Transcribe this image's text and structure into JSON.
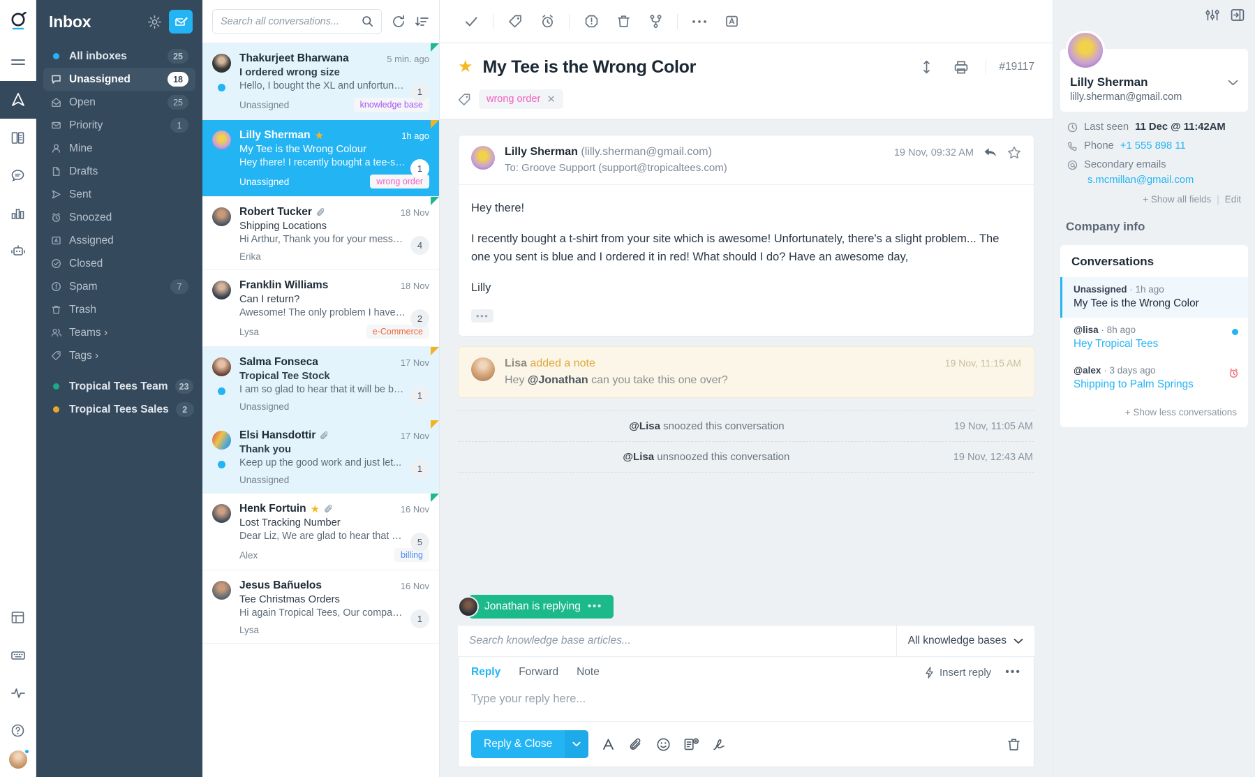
{
  "rail": {
    "logo": "groove-logo",
    "items": [
      {
        "name": "menu-icon",
        "active": false
      },
      {
        "name": "navigator-icon",
        "active": true
      },
      {
        "name": "knowledge-base-icon",
        "active": false
      },
      {
        "name": "chat-icon",
        "active": false
      },
      {
        "name": "reports-icon",
        "active": false
      },
      {
        "name": "bot-icon",
        "active": false
      },
      {
        "name": "grid-icon",
        "active": false
      },
      {
        "name": "keyboard-icon",
        "active": false
      },
      {
        "name": "pulse-icon",
        "active": false
      },
      {
        "name": "help-icon",
        "active": false
      }
    ]
  },
  "sidebar": {
    "title": "Inbox",
    "gear_label": "Settings",
    "compose_label": "Compose",
    "items": [
      {
        "label": "All inboxes",
        "count": "25",
        "icon": "bullet",
        "bullet_color": "#23b4f4",
        "style": "bold"
      },
      {
        "label": "Unassigned",
        "count": "18",
        "icon": "unassigned-icon",
        "style": "selected"
      },
      {
        "label": "Open",
        "count": "25",
        "icon": "open-envelope-icon",
        "style": "normal"
      },
      {
        "label": "Priority",
        "count": "1",
        "icon": "priority-envelope-icon",
        "style": "normal"
      },
      {
        "label": "Mine",
        "count": "",
        "icon": "person-icon",
        "style": "normal"
      },
      {
        "label": "Drafts",
        "count": "",
        "icon": "document-icon",
        "style": "normal"
      },
      {
        "label": "Sent",
        "count": "",
        "icon": "send-icon",
        "style": "normal"
      },
      {
        "label": "Snoozed",
        "count": "",
        "icon": "alarm-icon",
        "style": "normal"
      },
      {
        "label": "Assigned",
        "count": "",
        "icon": "assigned-icon",
        "style": "normal"
      },
      {
        "label": "Closed",
        "count": "",
        "icon": "check-circle-icon",
        "style": "normal"
      },
      {
        "label": "Spam",
        "count": "7",
        "icon": "exclamation-circle-icon",
        "style": "normal"
      },
      {
        "label": "Trash",
        "count": "",
        "icon": "trash-icon",
        "style": "normal"
      },
      {
        "label": "Teams ›",
        "count": "",
        "icon": "people-icon",
        "style": "normal"
      },
      {
        "label": "Tags ›",
        "count": "",
        "icon": "tag-icon",
        "style": "normal"
      }
    ],
    "groups": [
      {
        "label": "Tropical Tees Team",
        "count": "23",
        "bullet_color": "#1ba98a"
      },
      {
        "label": "Tropical Tees Sales",
        "count": "2",
        "bullet_color": "#e8a82c"
      }
    ]
  },
  "conversation_list": {
    "search_placeholder": "Search all conversations...",
    "refresh_label": "Refresh",
    "sort_label": "Sort",
    "items": [
      {
        "name": "Thakurjeet Bharwana",
        "time": "5 min. ago",
        "subject": "I ordered wrong size",
        "preview": "Hello, I bought the XL and unfortuna...",
        "assignee": "Unassigned",
        "tag": "knowledge base",
        "tag_color": "#a855f7",
        "count": "1",
        "unread": true,
        "starred": false,
        "attachment": false,
        "corner": "green",
        "bold_subject": true,
        "avatar_class": "av-thakurjeet"
      },
      {
        "name": "Lilly Sherman",
        "time": "1h ago",
        "subject": "My Tee is the Wrong Colour",
        "preview": "Hey there! I recently bought a tee-sh...",
        "assignee": "Unassigned",
        "tag": "wrong order",
        "tag_color": "#f35ec0",
        "count": "1",
        "unread": false,
        "starred": true,
        "attachment": false,
        "corner": "yellow",
        "bold_subject": false,
        "avatar_class": "av-lilly",
        "active": true
      },
      {
        "name": "Robert Tucker",
        "time": "18 Nov",
        "subject": "Shipping Locations",
        "preview": "Hi Arthur, Thank you for your messa...",
        "assignee": "Erika",
        "tag": "",
        "tag_color": "",
        "count": "4",
        "unread": false,
        "starred": false,
        "attachment": true,
        "corner": "green",
        "bold_subject": false,
        "avatar_class": "av-robert"
      },
      {
        "name": "Franklin Williams",
        "time": "18 Nov",
        "subject": "Can I return?",
        "preview": "Awesome! The only problem I have i...",
        "assignee": "Lysa",
        "tag": "e-Commerce",
        "tag_color": "#f0663a",
        "count": "2",
        "unread": false,
        "starred": false,
        "attachment": false,
        "corner": "",
        "bold_subject": false,
        "avatar_class": "av-franklin"
      },
      {
        "name": "Salma Fonseca",
        "time": "17 Nov",
        "subject": "Tropical Tee Stock",
        "preview": "I am so glad to hear that it will be ba...",
        "assignee": "Unassigned",
        "tag": "",
        "tag_color": "",
        "count": "1",
        "unread": true,
        "starred": false,
        "attachment": false,
        "corner": "yellow",
        "bold_subject": true,
        "avatar_class": "av-salma"
      },
      {
        "name": "Elsi Hansdottir",
        "time": "17 Nov",
        "subject": "Thank you",
        "preview": "Keep up the good work and just let...",
        "assignee": "Unassigned",
        "tag": "",
        "tag_color": "",
        "count": "1",
        "unread": true,
        "starred": false,
        "attachment": true,
        "corner": "yellow",
        "bold_subject": true,
        "avatar_class": "av-elsi"
      },
      {
        "name": "Henk Fortuin",
        "time": "16 Nov",
        "subject": "Lost Tracking Number",
        "preview": "Dear Liz, We are glad to hear that yo...",
        "assignee": "Alex",
        "tag": "billing",
        "tag_color": "#4b8ef0",
        "count": "5",
        "unread": false,
        "starred": true,
        "attachment": true,
        "corner": "green",
        "bold_subject": false,
        "avatar_class": "av-henk"
      },
      {
        "name": "Jesus Bañuelos",
        "time": "16 Nov",
        "subject": "Tee Christmas Orders",
        "preview": "Hi again Tropical Tees, Our company...",
        "assignee": "Lysa",
        "tag": "",
        "tag_color": "",
        "count": "1",
        "unread": false,
        "starred": false,
        "attachment": false,
        "corner": "",
        "bold_subject": false,
        "avatar_class": "av-jesus"
      }
    ]
  },
  "toolbar": {
    "buttons": [
      {
        "name": "close-check-icon",
        "label": "Close"
      },
      {
        "name": "tag-icon",
        "label": "Tag"
      },
      {
        "name": "snooze-alarm-icon",
        "label": "Snooze"
      },
      {
        "name": "priority-icon",
        "label": "Priority"
      },
      {
        "name": "delete-trash-icon",
        "label": "Delete"
      },
      {
        "name": "merge-icon",
        "label": "Merge"
      },
      {
        "name": "more-dots-icon",
        "label": "More"
      },
      {
        "name": "assign-icon",
        "label": "Assign"
      }
    ]
  },
  "conversation": {
    "subject": "My Tee is the Wrong Color",
    "ticket_id": "#19117",
    "starred": true,
    "tag": "wrong order",
    "collapse_label": "Expand/collapse",
    "print_label": "Print",
    "message": {
      "author": "Lilly Sherman",
      "author_email": "(lilly.sherman@gmail.com)",
      "to": "To: Groove Support (support@tropicaltees.com)",
      "date": "19 Nov, 09:32 AM",
      "paragraphs": [
        "Hey there!",
        "I recently bought a t-shirt from your site which is awesome! Unfortunately, there's a slight problem... The one you sent is blue and I ordered it in red! What should I do? Have an awesome day,",
        "Lilly"
      ],
      "reply_label": "Reply",
      "star_label": "Star"
    },
    "note": {
      "author": "Lisa",
      "action": "added a note",
      "text_prefix": "Hey ",
      "mention": "@Jonathan",
      "text_suffix": " can you take this one over?",
      "time": "19 Nov, 11:15 AM"
    },
    "events": [
      {
        "mention": "@Lisa",
        "action": " snoozed this conversation",
        "time": "19 Nov, 11:05 AM"
      },
      {
        "mention": "@Lisa",
        "action": " unsnoozed this conversation",
        "time": "19 Nov, 12:43 AM"
      }
    ],
    "typing_indicator": "Jonathan is replying"
  },
  "composer": {
    "kb_placeholder": "Search knowledge base articles...",
    "kb_select": "All knowledge bases",
    "tabs": [
      {
        "label": "Reply",
        "active": true
      },
      {
        "label": "Forward",
        "active": false
      },
      {
        "label": "Note",
        "active": false
      }
    ],
    "insert_reply": "Insert reply",
    "more_label": "More options",
    "body_placeholder": "Type your reply here...",
    "send_label": "Reply & Close",
    "tools": [
      {
        "name": "text-format-icon",
        "label": "Formatting"
      },
      {
        "name": "attachment-icon",
        "label": "Attach file"
      },
      {
        "name": "emoji-icon",
        "label": "Emoji"
      },
      {
        "name": "canned-reply-icon",
        "label": "Canned reply"
      },
      {
        "name": "signature-icon",
        "label": "Signature"
      }
    ],
    "discard_label": "Discard"
  },
  "right_panel": {
    "settings_label": "Panel settings",
    "collapse_label": "Collapse panel",
    "contact": {
      "name": "Lilly Sherman",
      "email": "lilly.sherman@gmail.com",
      "fields": [
        {
          "icon": "clock-icon",
          "label": "Last seen",
          "value": "11 Dec @ 11:42AM",
          "link": false
        },
        {
          "icon": "phone-icon",
          "label": "Phone",
          "value": "+1 555 898 11",
          "link": true
        },
        {
          "icon": "at-icon",
          "label": "Secondary emails",
          "value": "",
          "link": false
        }
      ],
      "secondary_email": "s.mcmillan@gmail.com",
      "show_all_fields": "+ Show all fields",
      "edit": "Edit"
    },
    "company_info_title": "Company info",
    "conversations_title": "Conversations",
    "conversations": [
      {
        "meta_bold": "Unassigned",
        "meta_rest": " · 1h ago",
        "subject": "My Tee is the Wrong Color",
        "selected": true,
        "badge": ""
      },
      {
        "meta_bold": "@lisa",
        "meta_rest": " · 8h ago",
        "subject": "Hey Tropical Tees",
        "selected": false,
        "badge": "unread-dot"
      },
      {
        "meta_bold": "@alex",
        "meta_rest": " · 3 days ago",
        "subject": "Shipping to Palm Springs",
        "selected": false,
        "badge": "snooze-clock"
      }
    ],
    "show_less": "+ Show less conversations"
  }
}
